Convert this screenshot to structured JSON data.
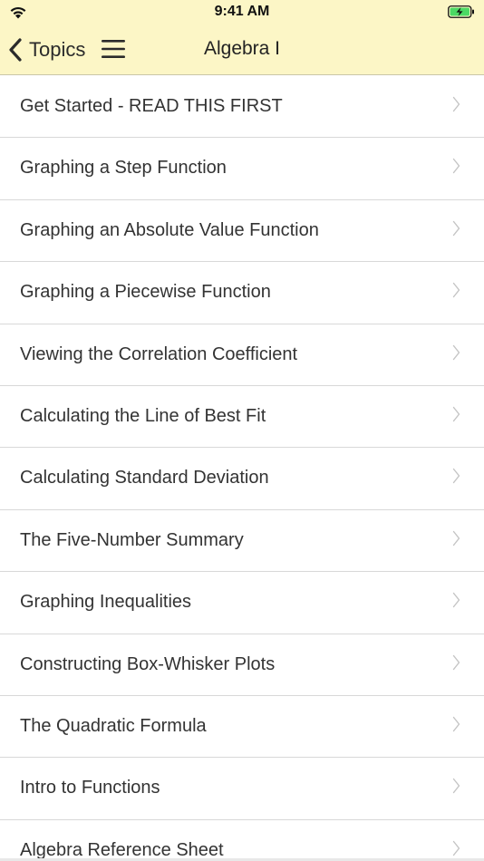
{
  "status_bar": {
    "time": "9:41 AM"
  },
  "nav": {
    "back_label": "Topics",
    "title": "Algebra I"
  },
  "icons": {
    "back": "chevron-left-icon",
    "menu": "hamburger-menu-icon",
    "row": "chevron-right-icon",
    "wifi": "wifi-icon",
    "battery": "battery-charging-icon"
  },
  "colors": {
    "nav_background": "#fcf6c6",
    "battery_fill": "#4cd964"
  },
  "topics": [
    {
      "label": "Get Started - READ THIS FIRST"
    },
    {
      "label": "Graphing a Step Function"
    },
    {
      "label": "Graphing an Absolute Value Function"
    },
    {
      "label": "Graphing a Piecewise Function"
    },
    {
      "label": "Viewing the Correlation Coefficient"
    },
    {
      "label": "Calculating the Line of Best Fit"
    },
    {
      "label": "Calculating Standard Deviation"
    },
    {
      "label": "The Five-Number Summary"
    },
    {
      "label": "Graphing Inequalities"
    },
    {
      "label": "Constructing Box-Whisker Plots"
    },
    {
      "label": "The Quadratic Formula"
    },
    {
      "label": "Intro to Functions"
    },
    {
      "label": "Algebra Reference Sheet"
    }
  ]
}
